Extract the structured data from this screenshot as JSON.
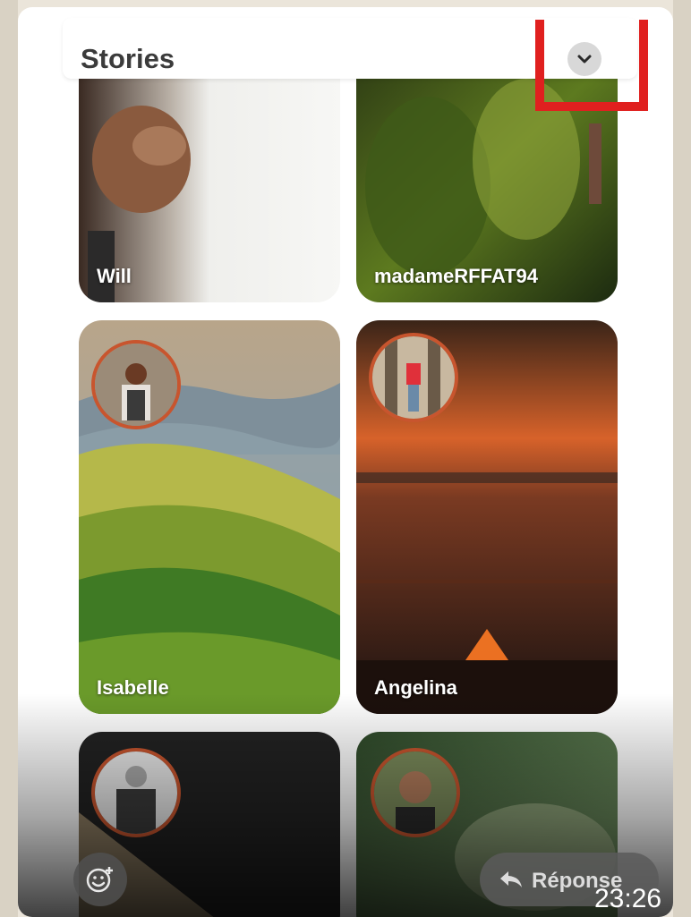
{
  "header": {
    "title": "Stories"
  },
  "stories": [
    {
      "name": "Will"
    },
    {
      "name": "madameRFFAT94"
    },
    {
      "name": "Isabelle"
    },
    {
      "name": "Angelina"
    },
    {
      "name": ""
    },
    {
      "name": ""
    }
  ],
  "reply": {
    "label": "Réponse",
    "icon": "reply-arrow-icon"
  },
  "message": {
    "time": "23:26"
  },
  "colors": {
    "highlight": "#e0201f",
    "avatar_ring": "#c8552e"
  }
}
